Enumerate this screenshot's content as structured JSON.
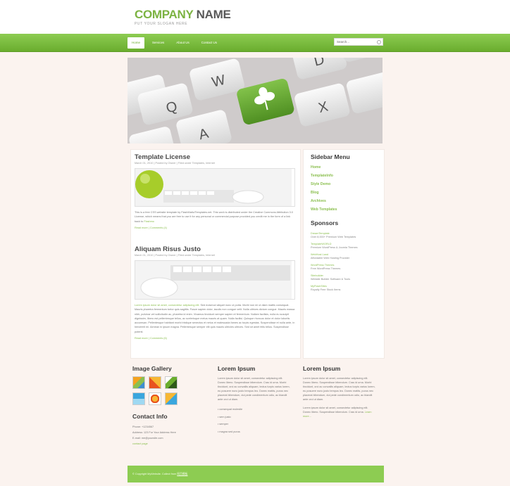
{
  "header": {
    "brand_part1": "COMPANY",
    "brand_part2": "NAME",
    "slogan": "PUT YOUR SLOGAN HERE"
  },
  "nav": {
    "items": [
      {
        "label": "Home",
        "active": true
      },
      {
        "label": "Services"
      },
      {
        "label": "About Us"
      },
      {
        "label": "Contact Us"
      }
    ]
  },
  "search": {
    "value": "Search..."
  },
  "posts": [
    {
      "title": "Template License",
      "meta": "March 01, 2010 | Posted by Owner | Filed under Templates, Internet",
      "text": "This is a free CSS website template by FlashMatic/Templates.net. This work is distributed under the Creative Commons Attribution 3.0 License, which means that you are free to use it for any personal or commercial purpose provided you credit me in the form of a link back to",
      "link": "Flashmo",
      "readmore": "Read more | Comments (4)"
    },
    {
      "title": "Aliquam Risus Justo",
      "meta": "March 01, 2010 | Posted by Owner | Filed under Templates, Internet",
      "lead_link": "Lorem ipsum dolor sit amet, consectetur adipiscing elit.",
      "text": "Sed euismod aliquet nunc ut porta. Morbi non mi ut diam mattis consequat. Mauris pharetra fermentum tortor quis sagittis. Fusce sapien dolor, iaculis non congue velit. Nulla ultrices dictum congue. Mauris massa nibh, pulvinar vel sollicitudin ac, pharetra id enim. Vivamus tincidunt semper sapien et fermentum. Nullam facilisis, nulla eu suscipit dignissim, libero est pellentesque tellus, ac scelerisque metus mauris at quam. Nulla facilisi. Quisque rhoncus dolor et dolor lobortis accumsan. Pellentesque habitant morbi tristique senectus et netus et malesuada fames ac turpis egestas. Suspendisse et nulla ante, in hendrerit mi. Aenean in ipsum magna. Pellentesque semper elit quis mauris ultricies ultrices. Sed sit amet felis tellus. Suspendisse potenti.",
      "readmore": "Read more | Comments (6)"
    }
  ],
  "sidebar": {
    "menu_title": "Sidebar Menu",
    "menu": [
      "Home",
      "TemplateInfo",
      "Style Demo",
      "Blog",
      "Archives",
      "Web Templates"
    ],
    "sponsors_title": "Sponsors",
    "sponsors": [
      {
        "name": "DreamTemplate",
        "desc": "Over 8,000+ Premium Web Templates"
      },
      {
        "name": "TemplateWORLD",
        "desc": "Premium WordPress & Joomla Themes"
      },
      {
        "name": "WebHost Land",
        "desc": "Affordable Web Hosting Provider"
      },
      {
        "name": "WordPress Themes",
        "desc": "Free WordPress Themes"
      },
      {
        "name": "Sitebuilder",
        "desc": "Website Builder Software & Tools"
      },
      {
        "name": "MyFlashSites",
        "desc": "Royalty Free Stock Items"
      }
    ]
  },
  "footer": {
    "gallery_title": "Image Gallery",
    "contact_title": "Contact Info",
    "contact": {
      "phone": "Phone: +1234567",
      "address": "Address: 123 For Your Address Here",
      "email": "E-mail: me@yoursite.com",
      "link": "contact page"
    },
    "col2": {
      "title": "Lorem Ipsum",
      "text": "Lorem ipsum dolor sit amet, consectetur adipiscing elit. Donec libero. Suspendisse bibendum. Cras id urna. Morbi tincidunt, orci ac convallis aliquam, lectus turpis varius lorem, eu posuere nunc justo tempus leo. Donec mattis, purus nec placerat bibendum, dui pede condimentum odio, ac blandit ante orci ut diam.",
      "list": [
        "consequat molestie",
        "sem justo",
        "semper",
        "magna sed purus"
      ]
    },
    "col3": {
      "title": "Lorem Ipsum",
      "text1": "Lorem ipsum dolor sit amet, consectetur adipiscing elit. Donec libero. Suspendisse bibendum. Cras id urna. Morbi tincidunt, orci ac convallis aliquam, lectus turpis varius lorem, eu posuere nunc justo tempus leo. Donec mattis, purus nec placerat bibendum, dui pede condimentum odio, ac blandit ante orci ut diam.",
      "text2": "Lorem ipsum dolor sit amet, consectetur adipiscing elit. Donec libero. Suspendisse bibendum. Cras id urna.",
      "link": "Learn more..."
    },
    "copyright_prefix": "© Copyright MyWebsite. Collect from",
    "copyright_link": "网页模板"
  },
  "colors": {
    "accent": "#8dcc52",
    "accent_dark": "#6aad2e",
    "background": "#fbf3ef"
  }
}
